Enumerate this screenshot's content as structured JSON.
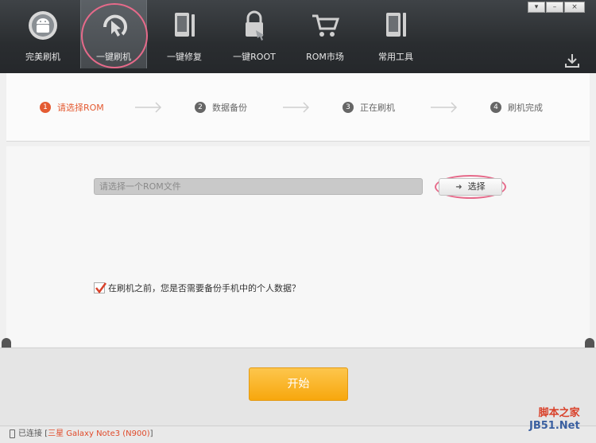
{
  "toolbar": {
    "items": [
      {
        "label": "完美刷机",
        "icon": "android-icon"
      },
      {
        "label": "一键刷机",
        "icon": "flash-hand-icon"
      },
      {
        "label": "一键修复",
        "icon": "phone-wrench-icon"
      },
      {
        "label": "一键ROOT",
        "icon": "lock-hand-icon"
      },
      {
        "label": "ROM市场",
        "icon": "shopping-cart-icon"
      },
      {
        "label": "常用工具",
        "icon": "phone-tools-icon"
      }
    ],
    "active_index": 1,
    "window_buttons": [
      "▾",
      "–",
      "×"
    ]
  },
  "steps": [
    {
      "num": "1",
      "label": "请选择ROM"
    },
    {
      "num": "2",
      "label": "数据备份"
    },
    {
      "num": "3",
      "label": "正在刷机"
    },
    {
      "num": "4",
      "label": "刷机完成"
    }
  ],
  "rom": {
    "placeholder": "请选择一个ROM文件",
    "choose_label": "选择"
  },
  "backup": {
    "label": "在刷机之前，您是否需要备份手机中的个人数据？",
    "checked": true
  },
  "start_label": "开始",
  "status": {
    "connected": "已连接",
    "device": "三星 Galaxy Note3 (N900)"
  },
  "watermark": {
    "line1": "脚本之家",
    "line2": "JB51.Net"
  },
  "colors": {
    "accent": "#e45b32",
    "start_button": "#f7a70d",
    "highlight_ring": "#e66a8a"
  }
}
